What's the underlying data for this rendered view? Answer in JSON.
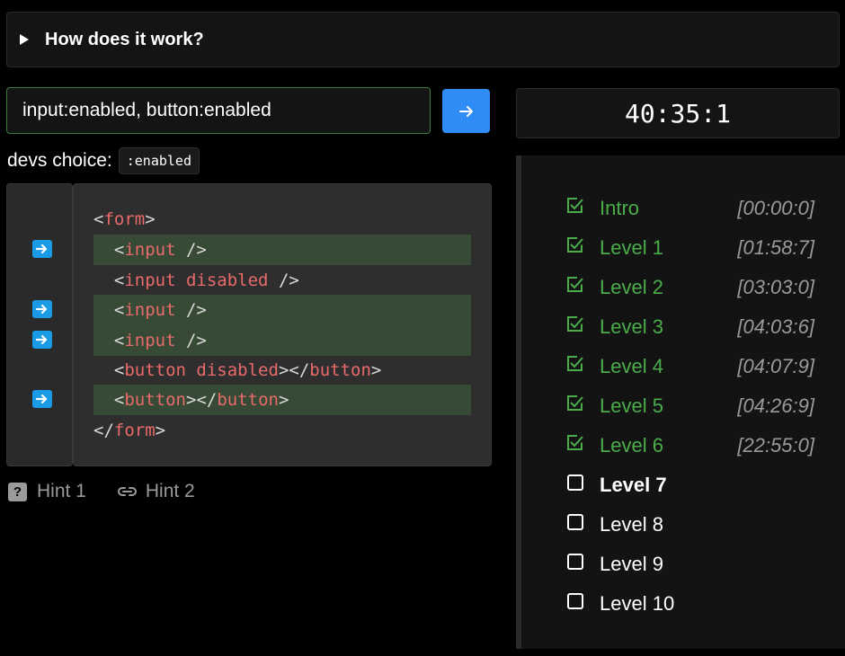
{
  "details": {
    "title": "How does it work?"
  },
  "selector": {
    "value": "input:enabled, button:enabled"
  },
  "devs_choice": {
    "label": "devs choice:",
    "code": ":enabled"
  },
  "code": {
    "lines": [
      {
        "open": "<",
        "tag": "form",
        "close": ">",
        "attr": "",
        "end": "",
        "endtag": "",
        "endclose": ""
      },
      {
        "open": "<",
        "tag": "input",
        "close": " />",
        "attr": "",
        "end": "",
        "endtag": "",
        "endclose": ""
      },
      {
        "open": "<",
        "tag": "input",
        "close": " />",
        "attr": " disabled",
        "end": "",
        "endtag": "",
        "endclose": ""
      },
      {
        "open": "<",
        "tag": "input",
        "close": " />",
        "attr": "",
        "end": "",
        "endtag": "",
        "endclose": ""
      },
      {
        "open": "<",
        "tag": "input",
        "close": " />",
        "attr": "",
        "end": "",
        "endtag": "",
        "endclose": ""
      },
      {
        "open": "<",
        "tag": "button",
        "close": ">",
        "attr": " disabled",
        "end": "</",
        "endtag": "button",
        "endclose": ">"
      },
      {
        "open": "<",
        "tag": "button",
        "close": ">",
        "attr": "",
        "end": "</",
        "endtag": "button",
        "endclose": ">"
      },
      {
        "open": "</",
        "tag": "form",
        "close": ">",
        "attr": "",
        "end": "",
        "endtag": "",
        "endclose": ""
      }
    ],
    "highlighted": [
      1,
      3,
      4,
      6
    ]
  },
  "hints": {
    "hint1": "Hint 1",
    "hint2": "Hint 2"
  },
  "timer": "40:35:1",
  "levels": [
    {
      "name": "Intro",
      "time": "[00:00:0]",
      "done": true
    },
    {
      "name": "Level 1",
      "time": "[01:58:7]",
      "done": true
    },
    {
      "name": "Level 2",
      "time": "[03:03:0]",
      "done": true
    },
    {
      "name": "Level 3",
      "time": "[04:03:6]",
      "done": true
    },
    {
      "name": "Level 4",
      "time": "[04:07:9]",
      "done": true
    },
    {
      "name": "Level 5",
      "time": "[04:26:9]",
      "done": true
    },
    {
      "name": "Level 6",
      "time": "[22:55:0]",
      "done": true
    },
    {
      "name": "Level 7",
      "time": "",
      "done": false,
      "current": true
    },
    {
      "name": "Level 8",
      "time": "",
      "done": false
    },
    {
      "name": "Level 9",
      "time": "",
      "done": false
    },
    {
      "name": "Level 10",
      "time": "",
      "done": false
    }
  ],
  "colors": {
    "accent": "#2f8cf5",
    "done": "#4aad4a",
    "tag": "#e96a6a",
    "highlight": "#364a36"
  }
}
